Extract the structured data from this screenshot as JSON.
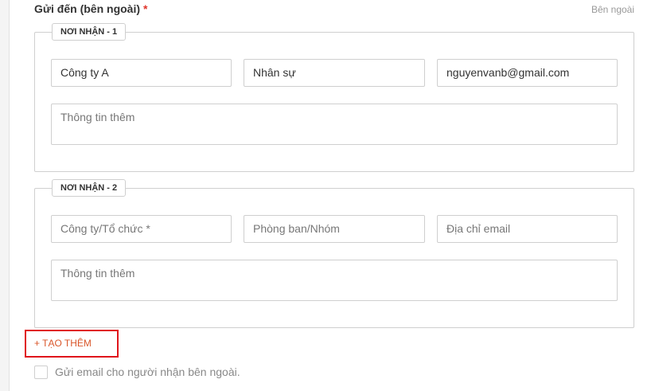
{
  "section": {
    "title": "Gửi đến (bên ngoài)",
    "required_mark": "*",
    "hint": "Bên ngoài"
  },
  "recipients": [
    {
      "tag": "NƠI NHẬN - 1",
      "company": "Công ty A",
      "department": "Nhân sự",
      "email": "nguyenvanb@gmail.com",
      "extra_placeholder": "Thông tin thêm"
    },
    {
      "tag": "NƠI NHẬN - 2",
      "company_placeholder": "Công ty/Tổ chức *",
      "department_placeholder": "Phòng ban/Nhóm",
      "email_placeholder": "Địa chỉ email",
      "extra_placeholder": "Thông tin thêm"
    }
  ],
  "add_more_label": "+ TẠO THÊM",
  "send_email_checkbox": {
    "label": "Gửi email cho người nhận bên ngoài.",
    "checked": false
  },
  "colors": {
    "required": "#e0352b",
    "accent": "#d9572b",
    "highlight_border": "#e0151b"
  }
}
